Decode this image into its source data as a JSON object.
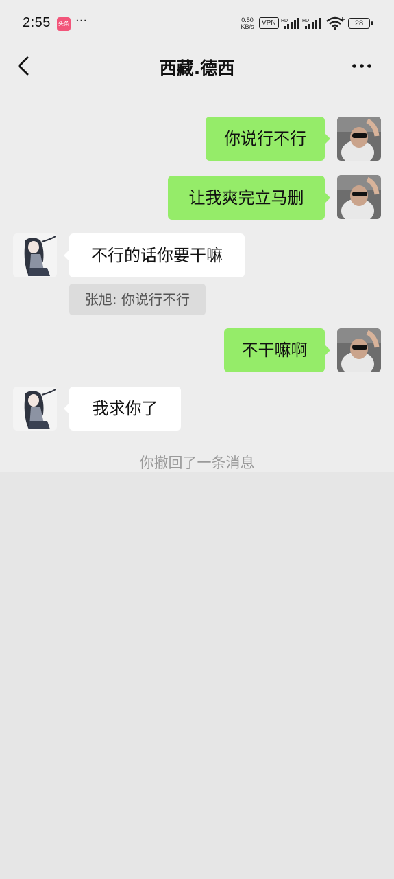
{
  "status_bar": {
    "time": "2:55",
    "app_badge": "头条",
    "overflow_dots": "···",
    "net_speed_value": "0.50",
    "net_speed_unit": "KB/s",
    "vpn": "VPN",
    "signal_1_label": "HD",
    "signal_2_label": "HD",
    "battery": "28"
  },
  "header": {
    "title": "西藏.德西",
    "back_icon": "chevron-left-icon",
    "more_icon": "more-dots-icon"
  },
  "messages": [
    {
      "direction": "outgoing",
      "text": "你说行不行"
    },
    {
      "direction": "outgoing",
      "text": "让我爽完立马删"
    },
    {
      "direction": "incoming",
      "text": "不行的话你要干嘛",
      "quote": "张旭: 你说行不行"
    },
    {
      "direction": "outgoing",
      "text": "不干嘛啊"
    },
    {
      "direction": "incoming",
      "text": "我求你了"
    }
  ],
  "system_notice": "你撤回了一条消息",
  "colors": {
    "background": "#ededed",
    "outgoing_bubble": "#95ec69",
    "incoming_bubble": "#ffffff",
    "quote_bg": "#dcdcdc"
  }
}
